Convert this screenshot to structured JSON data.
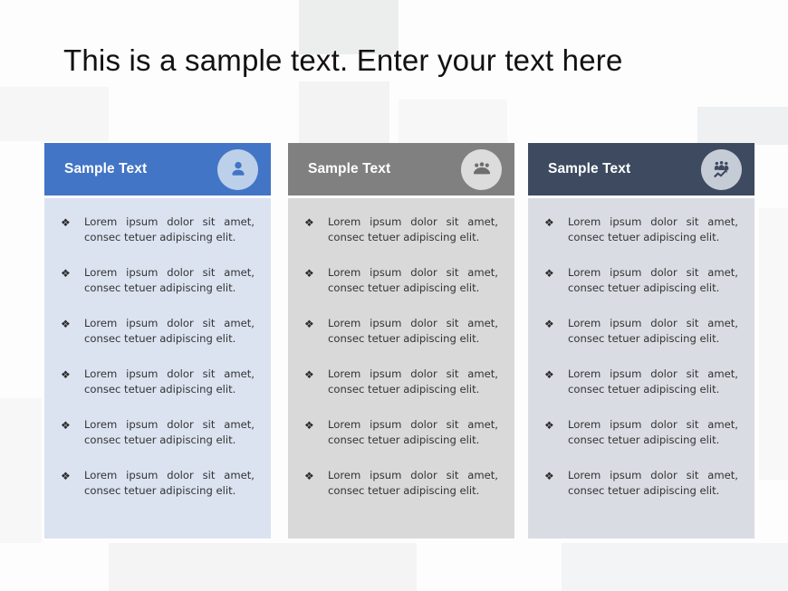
{
  "slide": {
    "title": "This is a sample text. Enter your text here",
    "background_color": "#fdfdfd"
  },
  "bullet_symbol": "❖",
  "bullet_text": "Lorem ipsum dolor sit amet, consec tetuer adipiscing elit.",
  "cards": [
    {
      "id": "card-1",
      "heading": "Sample Text",
      "icon": "person-icon",
      "header_color": "#4275c5",
      "body_color": "#dbe3f1",
      "icon_circle_color": "#bdd0ea",
      "bullets": [
        "Lorem ipsum dolor sit amet, consec tetuer adipiscing elit.",
        "Lorem ipsum dolor sit amet, consec tetuer adipiscing elit.",
        "Lorem ipsum dolor sit amet, consec tetuer adipiscing elit.",
        "Lorem ipsum dolor sit amet, consec tetuer adipiscing elit.",
        "Lorem ipsum dolor sit amet, consec tetuer adipiscing elit.",
        "Lorem ipsum dolor sit amet, consec tetuer adipiscing elit."
      ]
    },
    {
      "id": "card-2",
      "heading": "Sample Text",
      "icon": "people-group-icon",
      "header_color": "#808080",
      "body_color": "#d9d9d9",
      "icon_circle_color": "#dcdcdc",
      "bullets": [
        "Lorem ipsum dolor sit amet, consec tetuer adipiscing elit.",
        "Lorem ipsum dolor sit amet, consec tetuer adipiscing elit.",
        "Lorem ipsum dolor sit amet, consec tetuer adipiscing elit.",
        "Lorem ipsum dolor sit amet, consec tetuer adipiscing elit.",
        "Lorem ipsum dolor sit amet, consec tetuer adipiscing elit.",
        "Lorem ipsum dolor sit amet, consec tetuer adipiscing elit."
      ]
    },
    {
      "id": "card-3",
      "heading": "Sample Text",
      "icon": "people-growth-chart-icon",
      "header_color": "#3d4a60",
      "body_color": "#d9dce2",
      "icon_circle_color": "#c6ccd6",
      "bullets": [
        "Lorem ipsum dolor sit amet, consec tetuer adipiscing elit.",
        "Lorem ipsum dolor sit amet, consec tetuer adipiscing elit.",
        "Lorem ipsum dolor sit amet, consec tetuer adipiscing elit.",
        "Lorem ipsum dolor sit amet, consec tetuer adipiscing elit.",
        "Lorem ipsum dolor sit amet, consec tetuer adipiscing elit.",
        "Lorem ipsum dolor sit amet, consec tetuer adipiscing elit."
      ]
    }
  ]
}
